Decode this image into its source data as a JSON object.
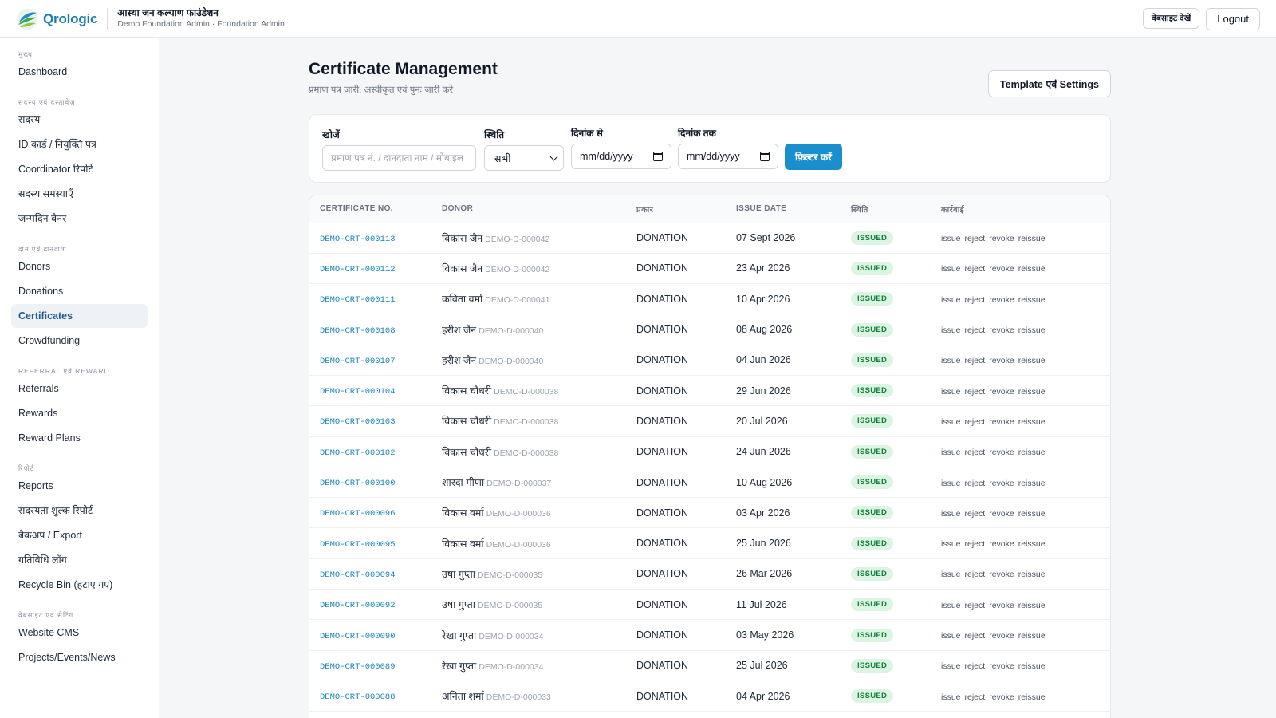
{
  "header": {
    "brand": "Qrologic",
    "org_name": "आस्था जन कल्याण फाउंडेशन",
    "org_sub": "Demo Foundation Admin · Foundation Admin",
    "website_button": "वेबसाइट देखें",
    "logout_button": "Logout"
  },
  "sidebar": {
    "sections": [
      {
        "label": "मुख्य",
        "items": [
          {
            "label": "Dashboard"
          }
        ]
      },
      {
        "label": "सदस्य एवं दस्तावेज़",
        "items": [
          {
            "label": "सदस्य"
          },
          {
            "label": "ID कार्ड / नियुक्ति पत्र"
          },
          {
            "label": "Coordinator रिपोर्ट"
          },
          {
            "label": "सदस्य समस्याएँ"
          },
          {
            "label": "जन्मदिन बैनर"
          }
        ]
      },
      {
        "label": "दान एवं दानदाता",
        "items": [
          {
            "label": "Donors"
          },
          {
            "label": "Donations"
          },
          {
            "label": "Certificates"
          },
          {
            "label": "Crowdfunding"
          }
        ]
      },
      {
        "label": "REFERRAL एवं REWARD",
        "items": [
          {
            "label": "Referrals"
          },
          {
            "label": "Rewards"
          },
          {
            "label": "Reward Plans"
          }
        ]
      },
      {
        "label": "रिपोर्ट",
        "items": [
          {
            "label": "Reports"
          },
          {
            "label": "सदस्यता शुल्क रिपोर्ट"
          },
          {
            "label": "बैकअप / Export"
          },
          {
            "label": "गतिविधि लॉग"
          },
          {
            "label": "Recycle Bin (हटाए गए)"
          }
        ]
      },
      {
        "label": "वेबसाइट एवं सेटिंग",
        "items": [
          {
            "label": "Website CMS"
          },
          {
            "label": "Projects/Events/News"
          }
        ]
      }
    ],
    "active": "Certificates"
  },
  "page": {
    "title": "Certificate Management",
    "subtitle": "प्रमाण पत्र जारी, अस्वीकृत एवं पुनः जारी करें",
    "template_button": "Template एवं Settings"
  },
  "filters": {
    "search_label": "खोजें",
    "search_placeholder": "प्रमाण पत्र नं. / दानदाता नाम / मोबाइल",
    "status_label": "स्थिति",
    "status_value": "सभी",
    "from_label": "दिनांक से",
    "from_value": "mm/dd/yyyy",
    "to_label": "दिनांक तक",
    "to_value": "mm/dd/yyyy",
    "filter_button": "फ़िल्टर करें"
  },
  "table": {
    "columns": [
      "CERTIFICATE NO.",
      "DONOR",
      "प्रकार",
      "ISSUE DATE",
      "स्थिति",
      "कार्रवाई"
    ],
    "actions": [
      "issue",
      "reject",
      "revoke",
      "reissue"
    ],
    "rows": [
      {
        "cert": "DEMO-CRT-000113",
        "donor": "विकास जैन",
        "code": "DEMO-D-000042",
        "type": "DONATION",
        "date": "07 Sept 2026",
        "status": "ISSUED"
      },
      {
        "cert": "DEMO-CRT-000112",
        "donor": "विकास जैन",
        "code": "DEMO-D-000042",
        "type": "DONATION",
        "date": "23 Apr 2026",
        "status": "ISSUED"
      },
      {
        "cert": "DEMO-CRT-000111",
        "donor": "कविता वर्मा",
        "code": "DEMO-D-000041",
        "type": "DONATION",
        "date": "10 Apr 2026",
        "status": "ISSUED"
      },
      {
        "cert": "DEMO-CRT-000108",
        "donor": "हरीश जैन",
        "code": "DEMO-D-000040",
        "type": "DONATION",
        "date": "08 Aug 2026",
        "status": "ISSUED"
      },
      {
        "cert": "DEMO-CRT-000107",
        "donor": "हरीश जैन",
        "code": "DEMO-D-000040",
        "type": "DONATION",
        "date": "04 Jun 2026",
        "status": "ISSUED"
      },
      {
        "cert": "DEMO-CRT-000104",
        "donor": "विकास चौधरी",
        "code": "DEMO-D-000038",
        "type": "DONATION",
        "date": "29 Jun 2026",
        "status": "ISSUED"
      },
      {
        "cert": "DEMO-CRT-000103",
        "donor": "विकास चौधरी",
        "code": "DEMO-D-000038",
        "type": "DONATION",
        "date": "20 Jul 2026",
        "status": "ISSUED"
      },
      {
        "cert": "DEMO-CRT-000102",
        "donor": "विकास चौधरी",
        "code": "DEMO-D-000038",
        "type": "DONATION",
        "date": "24 Jun 2026",
        "status": "ISSUED"
      },
      {
        "cert": "DEMO-CRT-000100",
        "donor": "शारदा मीणा",
        "code": "DEMO-D-000037",
        "type": "DONATION",
        "date": "10 Aug 2026",
        "status": "ISSUED"
      },
      {
        "cert": "DEMO-CRT-000096",
        "donor": "विकास वर्मा",
        "code": "DEMO-D-000036",
        "type": "DONATION",
        "date": "03 Apr 2026",
        "status": "ISSUED"
      },
      {
        "cert": "DEMO-CRT-000095",
        "donor": "विकास वर्मा",
        "code": "DEMO-D-000036",
        "type": "DONATION",
        "date": "25 Jun 2026",
        "status": "ISSUED"
      },
      {
        "cert": "DEMO-CRT-000094",
        "donor": "उषा गुप्ता",
        "code": "DEMO-D-000035",
        "type": "DONATION",
        "date": "26 Mar 2026",
        "status": "ISSUED"
      },
      {
        "cert": "DEMO-CRT-000092",
        "donor": "उषा गुप्ता",
        "code": "DEMO-D-000035",
        "type": "DONATION",
        "date": "11 Jul 2026",
        "status": "ISSUED"
      },
      {
        "cert": "DEMO-CRT-000090",
        "donor": "रेखा गुप्ता",
        "code": "DEMO-D-000034",
        "type": "DONATION",
        "date": "03 May 2026",
        "status": "ISSUED"
      },
      {
        "cert": "DEMO-CRT-000089",
        "donor": "रेखा गुप्ता",
        "code": "DEMO-D-000034",
        "type": "DONATION",
        "date": "25 Jul 2026",
        "status": "ISSUED"
      },
      {
        "cert": "DEMO-CRT-000088",
        "donor": "अनिता शर्मा",
        "code": "DEMO-D-000033",
        "type": "DONATION",
        "date": "04 Apr 2026",
        "status": "ISSUED"
      }
    ]
  },
  "colors": {
    "accent": "#1a8fcd",
    "badge_bg": "#dcf5e3",
    "badge_text": "#15803d",
    "link": "#1a84b8"
  }
}
